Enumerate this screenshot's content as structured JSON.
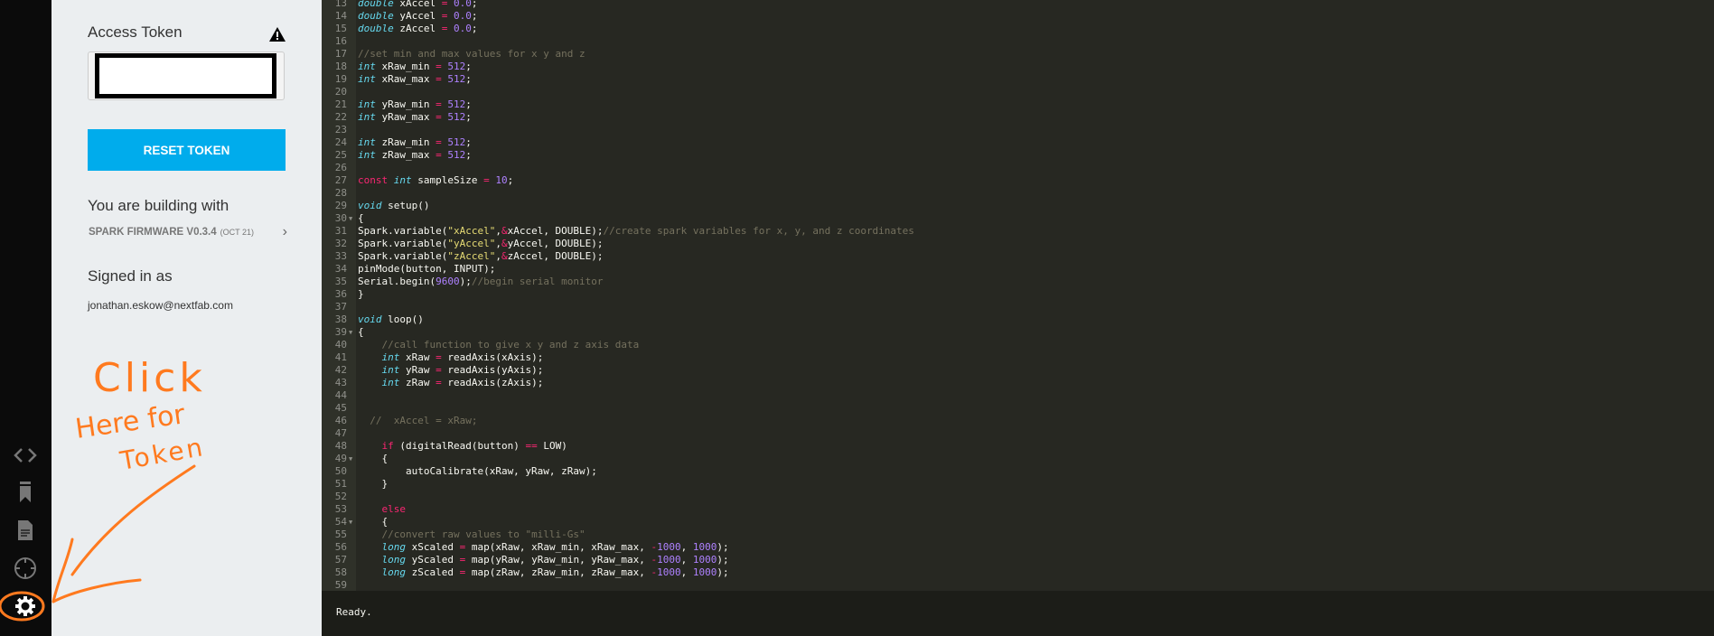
{
  "rail": {
    "icons": [
      "code-icon",
      "bookmark-icon",
      "document-icon",
      "crosshair-icon",
      "gear-icon"
    ]
  },
  "panel": {
    "access_token_title": "Access Token",
    "token_value": "",
    "reset_button": "RESET TOKEN",
    "building_title": "You are building with",
    "firmware": "SPARK FIRMWARE V0.3.4",
    "firmware_date": "(OCT 21)",
    "signed_in_title": "Signed in as",
    "email": "jonathan.eskow@nextfab.com"
  },
  "annotation": {
    "line1": "Click",
    "line2": "Here for",
    "line3": "Token",
    "color": "#ff7a1f"
  },
  "colors": {
    "accent": "#00acec",
    "editor_bg": "#272822"
  },
  "editor": {
    "first_line": 13,
    "folds": [
      30,
      39,
      49,
      54
    ],
    "lines": [
      [
        [
          "t",
          "double"
        ],
        [
          "p",
          " xAccel "
        ],
        [
          "o",
          "="
        ],
        [
          "p",
          " "
        ],
        [
          "n",
          "0.0"
        ],
        [
          "p",
          ";"
        ]
      ],
      [
        [
          "t",
          "double"
        ],
        [
          "p",
          " yAccel "
        ],
        [
          "o",
          "="
        ],
        [
          "p",
          " "
        ],
        [
          "n",
          "0.0"
        ],
        [
          "p",
          ";"
        ]
      ],
      [
        [
          "t",
          "double"
        ],
        [
          "p",
          " zAccel "
        ],
        [
          "o",
          "="
        ],
        [
          "p",
          " "
        ],
        [
          "n",
          "0.0"
        ],
        [
          "p",
          ";"
        ]
      ],
      [],
      [
        [
          "c",
          "//set min and max values for x y and z"
        ]
      ],
      [
        [
          "t",
          "int"
        ],
        [
          "p",
          " xRaw_min "
        ],
        [
          "o",
          "="
        ],
        [
          "p",
          " "
        ],
        [
          "n",
          "512"
        ],
        [
          "p",
          ";"
        ]
      ],
      [
        [
          "t",
          "int"
        ],
        [
          "p",
          " xRaw_max "
        ],
        [
          "o",
          "="
        ],
        [
          "p",
          " "
        ],
        [
          "n",
          "512"
        ],
        [
          "p",
          ";"
        ]
      ],
      [],
      [
        [
          "t",
          "int"
        ],
        [
          "p",
          " yRaw_min "
        ],
        [
          "o",
          "="
        ],
        [
          "p",
          " "
        ],
        [
          "n",
          "512"
        ],
        [
          "p",
          ";"
        ]
      ],
      [
        [
          "t",
          "int"
        ],
        [
          "p",
          " yRaw_max "
        ],
        [
          "o",
          "="
        ],
        [
          "p",
          " "
        ],
        [
          "n",
          "512"
        ],
        [
          "p",
          ";"
        ]
      ],
      [],
      [
        [
          "t",
          "int"
        ],
        [
          "p",
          " zRaw_min "
        ],
        [
          "o",
          "="
        ],
        [
          "p",
          " "
        ],
        [
          "n",
          "512"
        ],
        [
          "p",
          ";"
        ]
      ],
      [
        [
          "t",
          "int"
        ],
        [
          "p",
          " zRaw_max "
        ],
        [
          "o",
          "="
        ],
        [
          "p",
          " "
        ],
        [
          "n",
          "512"
        ],
        [
          "p",
          ";"
        ]
      ],
      [],
      [
        [
          "k",
          "const"
        ],
        [
          "p",
          " "
        ],
        [
          "t",
          "int"
        ],
        [
          "p",
          " sampleSize "
        ],
        [
          "o",
          "="
        ],
        [
          "p",
          " "
        ],
        [
          "n",
          "10"
        ],
        [
          "p",
          ";"
        ]
      ],
      [],
      [
        [
          "t",
          "void"
        ],
        [
          "p",
          " setup()"
        ]
      ],
      [
        [
          "p",
          "{"
        ]
      ],
      [
        [
          "p",
          "Spark.variable("
        ],
        [
          "s",
          "\"xAccel\""
        ],
        [
          "p",
          ","
        ],
        [
          "o",
          "&"
        ],
        [
          "p",
          "xAccel, DOUBLE);"
        ],
        [
          "c",
          "//create spark variables for x, y, and z coordinates"
        ]
      ],
      [
        [
          "p",
          "Spark.variable("
        ],
        [
          "s",
          "\"yAccel\""
        ],
        [
          "p",
          ","
        ],
        [
          "o",
          "&"
        ],
        [
          "p",
          "yAccel, DOUBLE);"
        ]
      ],
      [
        [
          "p",
          "Spark.variable("
        ],
        [
          "s",
          "\"zAccel\""
        ],
        [
          "p",
          ","
        ],
        [
          "o",
          "&"
        ],
        [
          "p",
          "zAccel, DOUBLE);"
        ]
      ],
      [
        [
          "p",
          "pinMode(button, INPUT);"
        ]
      ],
      [
        [
          "p",
          "Serial.begin("
        ],
        [
          "n",
          "9600"
        ],
        [
          "p",
          ");"
        ],
        [
          "c",
          "//begin serial monitor"
        ]
      ],
      [
        [
          "p",
          "}"
        ]
      ],
      [],
      [
        [
          "t",
          "void"
        ],
        [
          "p",
          " loop()"
        ]
      ],
      [
        [
          "p",
          "{"
        ]
      ],
      [
        [
          "p",
          "    "
        ],
        [
          "c",
          "//call function to give x y and z axis data"
        ]
      ],
      [
        [
          "p",
          "    "
        ],
        [
          "t",
          "int"
        ],
        [
          "p",
          " xRaw "
        ],
        [
          "o",
          "="
        ],
        [
          "p",
          " readAxis(xAxis);"
        ]
      ],
      [
        [
          "p",
          "    "
        ],
        [
          "t",
          "int"
        ],
        [
          "p",
          " yRaw "
        ],
        [
          "o",
          "="
        ],
        [
          "p",
          " readAxis(yAxis);"
        ]
      ],
      [
        [
          "p",
          "    "
        ],
        [
          "t",
          "int"
        ],
        [
          "p",
          " zRaw "
        ],
        [
          "o",
          "="
        ],
        [
          "p",
          " readAxis(zAxis);"
        ]
      ],
      [],
      [],
      [
        [
          "c",
          "  //  xAccel = xRaw;"
        ]
      ],
      [],
      [
        [
          "p",
          "    "
        ],
        [
          "k",
          "if"
        ],
        [
          "p",
          " (digitalRead(button) "
        ],
        [
          "o",
          "=="
        ],
        [
          "p",
          " LOW)"
        ]
      ],
      [
        [
          "p",
          "    {"
        ]
      ],
      [
        [
          "p",
          "        autoCalibrate(xRaw, yRaw, zRaw);"
        ]
      ],
      [
        [
          "p",
          "    }"
        ]
      ],
      [],
      [
        [
          "p",
          "    "
        ],
        [
          "k",
          "else"
        ]
      ],
      [
        [
          "p",
          "    {"
        ]
      ],
      [
        [
          "p",
          "    "
        ],
        [
          "c",
          "//convert raw values to \"milli-Gs\""
        ]
      ],
      [
        [
          "p",
          "    "
        ],
        [
          "t",
          "long"
        ],
        [
          "p",
          " xScaled "
        ],
        [
          "o",
          "="
        ],
        [
          "p",
          " map(xRaw, xRaw_min, xRaw_max, "
        ],
        [
          "o",
          "-"
        ],
        [
          "n",
          "1000"
        ],
        [
          "p",
          ", "
        ],
        [
          "n",
          "1000"
        ],
        [
          "p",
          ");"
        ]
      ],
      [
        [
          "p",
          "    "
        ],
        [
          "t",
          "long"
        ],
        [
          "p",
          " yScaled "
        ],
        [
          "o",
          "="
        ],
        [
          "p",
          " map(yRaw, yRaw_min, yRaw_max, "
        ],
        [
          "o",
          "-"
        ],
        [
          "n",
          "1000"
        ],
        [
          "p",
          ", "
        ],
        [
          "n",
          "1000"
        ],
        [
          "p",
          ");"
        ]
      ],
      [
        [
          "p",
          "    "
        ],
        [
          "t",
          "long"
        ],
        [
          "p",
          " zScaled "
        ],
        [
          "o",
          "="
        ],
        [
          "p",
          " map(zRaw, zRaw_min, zRaw_max, "
        ],
        [
          "o",
          "-"
        ],
        [
          "n",
          "1000"
        ],
        [
          "p",
          ", "
        ],
        [
          "n",
          "1000"
        ],
        [
          "p",
          ");"
        ]
      ],
      []
    ]
  },
  "status": {
    "text": "Ready."
  }
}
